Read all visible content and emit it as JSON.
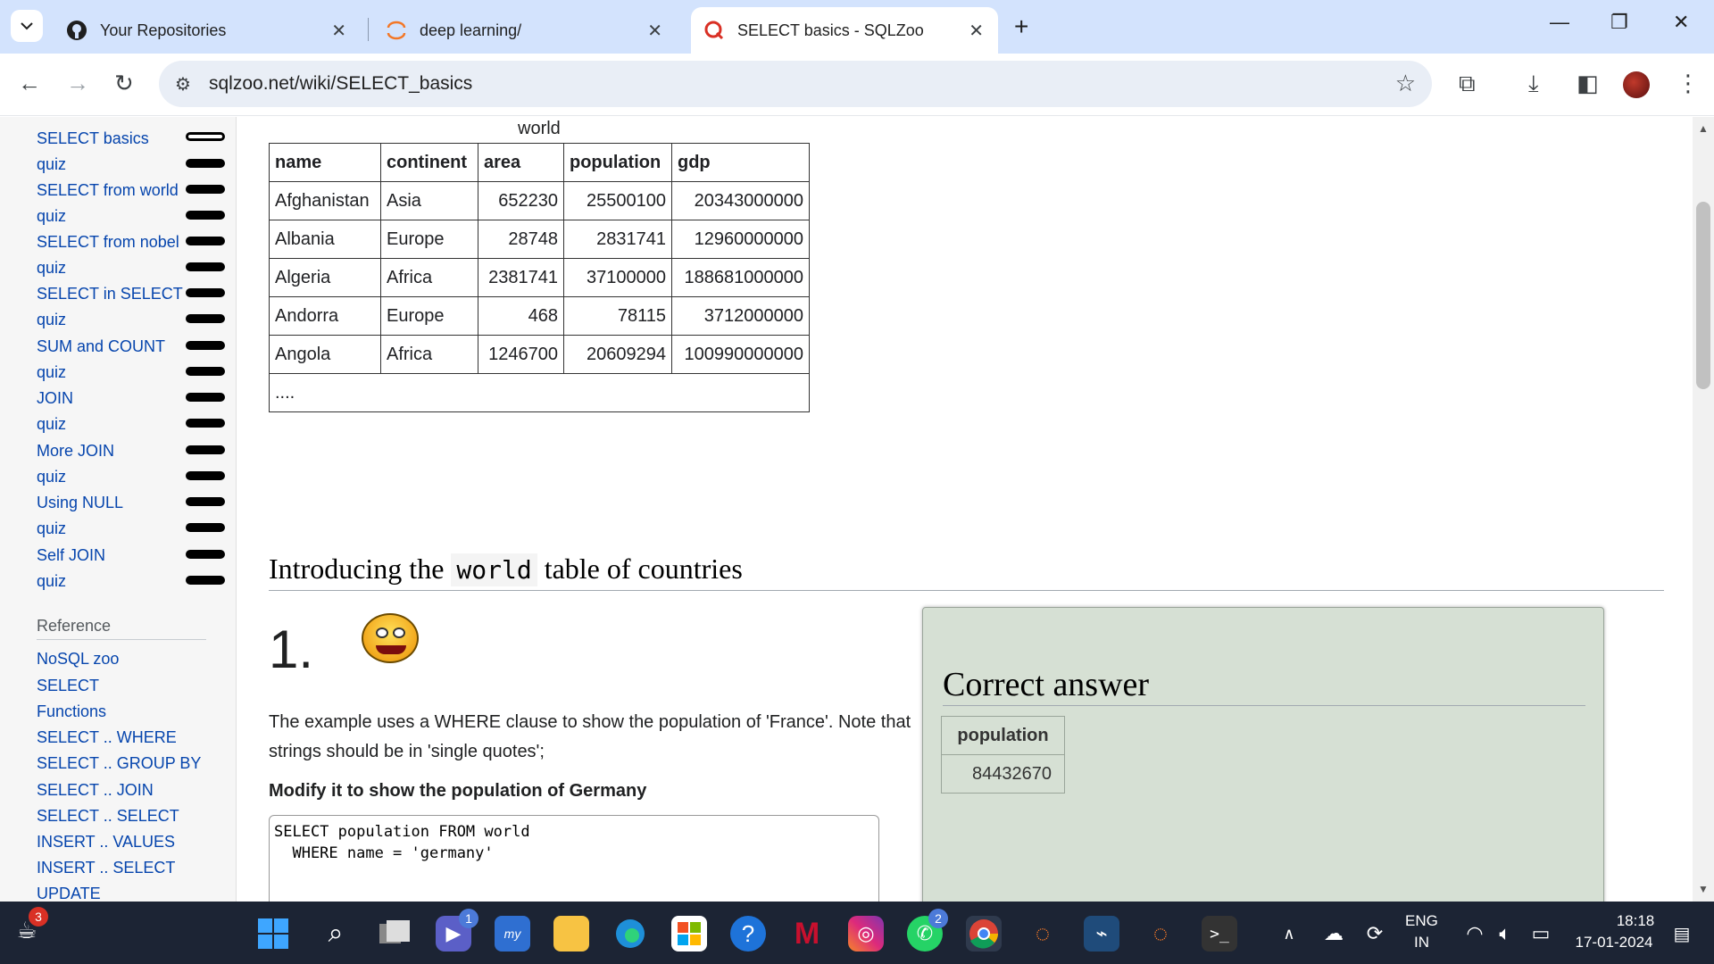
{
  "browser": {
    "tabs": [
      {
        "title": "Your Repositories",
        "favicon": "github-icon"
      },
      {
        "title": "deep learning/",
        "favicon": "jupyter-icon"
      },
      {
        "title": "SELECT basics - SQLZoo",
        "favicon": "sqlzoo-icon",
        "active": true
      }
    ],
    "url": "sqlzoo.net/wiki/SELECT_basics"
  },
  "sidebar": {
    "items": [
      {
        "label": "SELECT basics"
      },
      {
        "label": "quiz"
      },
      {
        "label": "SELECT from world"
      },
      {
        "label": "quiz"
      },
      {
        "label": "SELECT from nobel"
      },
      {
        "label": "quiz"
      },
      {
        "label": "SELECT in SELECT"
      },
      {
        "label": "quiz"
      },
      {
        "label": "SUM and COUNT"
      },
      {
        "label": "quiz"
      },
      {
        "label": "JOIN"
      },
      {
        "label": "quiz"
      },
      {
        "label": "More JOIN"
      },
      {
        "label": "quiz"
      },
      {
        "label": "Using NULL"
      },
      {
        "label": "quiz"
      },
      {
        "label": "Self JOIN"
      },
      {
        "label": "quiz"
      }
    ],
    "reference_heading": "Reference",
    "reference_items": [
      {
        "label": "NoSQL zoo"
      },
      {
        "label": "SELECT"
      },
      {
        "label": "Functions"
      },
      {
        "label": "SELECT .. WHERE"
      },
      {
        "label": "SELECT .. GROUP BY"
      },
      {
        "label": "SELECT .. JOIN"
      },
      {
        "label": "SELECT .. SELECT"
      },
      {
        "label": "INSERT .. VALUES"
      },
      {
        "label": "INSERT .. SELECT"
      },
      {
        "label": "UPDATE"
      }
    ]
  },
  "world_table": {
    "caption": "world",
    "headers": [
      "name",
      "continent",
      "area",
      "population",
      "gdp"
    ],
    "rows": [
      [
        "Afghanistan",
        "Asia",
        "652230",
        "25500100",
        "20343000000"
      ],
      [
        "Albania",
        "Europe",
        "28748",
        "2831741",
        "12960000000"
      ],
      [
        "Algeria",
        "Africa",
        "2381741",
        "37100000",
        "188681000000"
      ],
      [
        "Andorra",
        "Europe",
        "468",
        "78115",
        "3712000000"
      ],
      [
        "Angola",
        "Africa",
        "1246700",
        "20609294",
        "100990000000"
      ]
    ],
    "ellipsis": "...."
  },
  "section": {
    "title_before": "Introducing the ",
    "title_code": "world",
    "title_after": " table of countries"
  },
  "question": {
    "number": "1.",
    "text": "The example uses a WHERE clause to show the population of 'France'. Note that strings should be in 'single quotes';",
    "instruction": "Modify it to show the population of Germany",
    "sql": "SELECT population FROM world\n  WHERE name = 'germany'"
  },
  "answer": {
    "title": "Correct answer",
    "header": "population",
    "value": "84432670"
  },
  "taskbar": {
    "badges": {
      "widgets": "3",
      "teams": "1",
      "whatsapp": "2"
    },
    "lang_top": "ENG",
    "lang_bottom": "IN",
    "time": "18:18",
    "date": "17-01-2024"
  }
}
